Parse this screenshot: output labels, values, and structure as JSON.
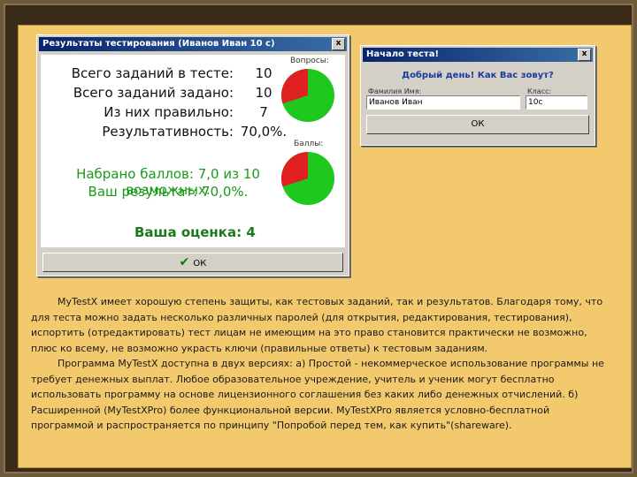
{
  "results_window": {
    "title": "Результаты тестирования (Иванов Иван 10 с)",
    "close": "x",
    "stats": [
      {
        "label": "Всего заданий в тесте:",
        "value": "10"
      },
      {
        "label": "Всего заданий задано:",
        "value": "10"
      },
      {
        "label": "Из них правильно:",
        "value": "7"
      },
      {
        "label": "Результативность:",
        "value": "70,0%."
      }
    ],
    "pie_questions_caption": "Вопросы:",
    "pie_points_caption": "Баллы:",
    "pie_questions_fraction": 0.7,
    "pie_points_fraction": 0.7,
    "score_line": "Набрано баллов: 7,0 из 10 возможных.",
    "result_line": "Ваш результат: 70,0%.",
    "grade": "Ваша оценка: 4",
    "ok_button": "ОК"
  },
  "start_window": {
    "title": "Начало теста!",
    "close": "x",
    "greeting": "Добрый день! Как Вас зовут?",
    "name_label": "Фамилия Имя:",
    "name_value": "Иванов Иван",
    "class_label": "Класс:",
    "class_value": "10с",
    "ok_button": "ОК"
  },
  "text": {
    "paragraph1": "MyTestX имеет хорошую степень защиты, как тестовых заданий, так и результатов. Благодаря тому, что для теста можно задать несколько различных паролей (для открытия, редактирования, тестирования), испортить (отредактировать) тест лицам не имеющим на это право становится практически не возможно, плюс ко всему, не возможно украсть ключи (правильные ответы) к тестовым заданиям.",
    "paragraph2": "Программа MyTestX доступна в двух версиях: а) Простой - некоммерческое использование программы не требует денежных выплат. Любое образовательное учреждение, учитель и ученик могут бесплатно использовать программу на основе лицензионного соглашения без каких либо денежных отчислений. б) Расширенной (MyTestXPro) более функциональной версии. MyTestXPro является условно-бесплатной программой и распространяется по принципу \"Попробой перед тем, как купить\"(shareware)."
  },
  "colors": {
    "pie_correct": "#1ec81e",
    "pie_wrong": "#e02020",
    "slide_bg": "#f3c96e",
    "title_bar": "#0a246a"
  }
}
